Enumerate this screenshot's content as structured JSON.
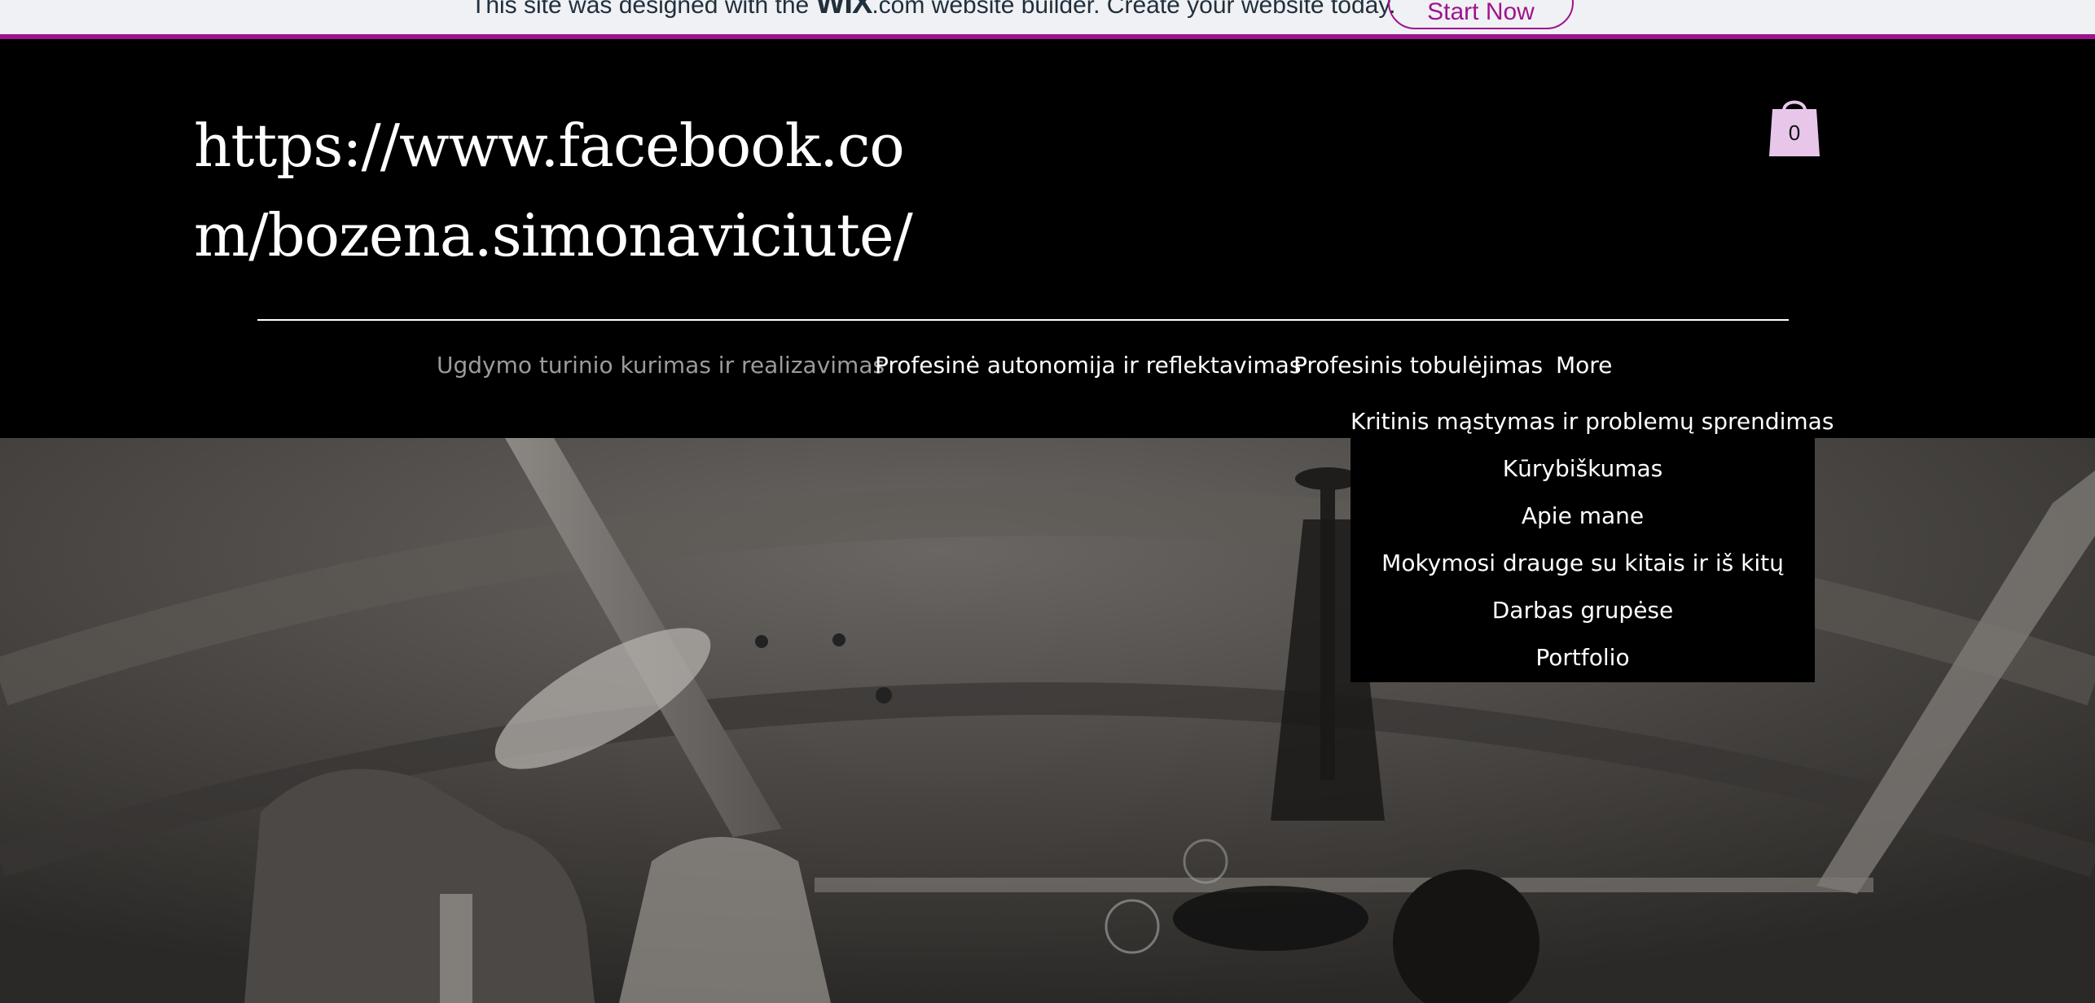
{
  "promo_banner": {
    "text_before_logo": "This site was designed with the ",
    "logo": "WIX",
    "text_after_logo": ".com website builder. Create your website today.",
    "button_label": "Start Now",
    "accent_color": "#a0138e"
  },
  "header": {
    "site_title": "https://www.facebook.com/bozena.simonaviciute/",
    "cart": {
      "icon": "shopping-bag-icon",
      "count": "0",
      "color": "#e8c6ea"
    }
  },
  "nav": {
    "items": [
      {
        "label": "Ugdymo turinio kurimas ir realizavimas",
        "active": true
      },
      {
        "label": "Profesinė autonomija ir reflektavimas",
        "active": false
      },
      {
        "label": "Profesinis tobulėjimas",
        "active": false
      },
      {
        "label": "More",
        "active": false
      }
    ]
  },
  "dropdown": {
    "items": [
      {
        "label": "Kritinis mąstymas ir problemų sprendimas"
      },
      {
        "label": "Kūrybiškumas"
      },
      {
        "label": "Apie mane"
      },
      {
        "label": "Mokymosi drauge su kitais ir iš kitų"
      },
      {
        "label": "Darbas grupėse"
      },
      {
        "label": "Portfolio"
      }
    ]
  }
}
